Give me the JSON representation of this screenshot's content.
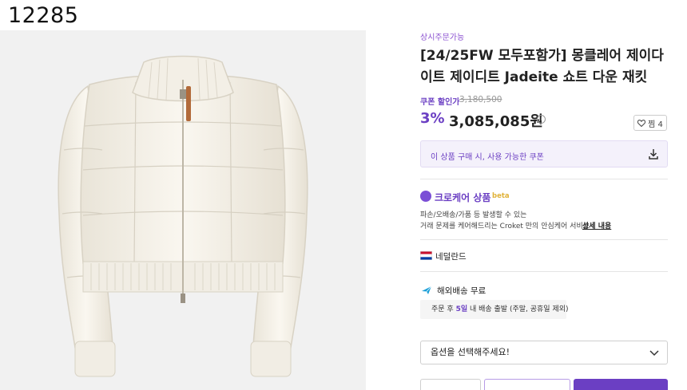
{
  "header": {
    "id_label": "12285"
  },
  "product": {
    "badge": "상시주문가능",
    "title": "[24/25FW 모두포함가] 몽클레어 제이다이트 제이디트 Jadeite 쇼트 다운 재킷",
    "coupon_label": "쿠폰 할인가",
    "original_price": "3,180,500",
    "discount_rate": "3%",
    "price": "3,085,085원",
    "wish_count": "찜 4",
    "coupon_banner": "이 상품 구매 시,  사용 가능한 쿠폰"
  },
  "care": {
    "title": "크로케어 상품",
    "beta": "beta",
    "desc_line1": "파손/오배송/가품 등 발생할 수 있는",
    "desc_line2": "거래 문제를 케어해드리는 Croket 만의 안심케어 서비스",
    "link": "상세 내용"
  },
  "origin": {
    "country": "네덜란드"
  },
  "shipping": {
    "label": "해외배송  무료",
    "note_prefix": "주문 후 ",
    "note_highlight": "5일",
    "note_suffix": " 내 배송 출발 (주말, 공휴일 제외)"
  },
  "options": {
    "placeholder": "옵션을 선택해주세요!"
  },
  "colors": {
    "accent": "#6b3fc3",
    "coupon_bg": "#f4f1fb",
    "beta": "#e0b23a"
  }
}
